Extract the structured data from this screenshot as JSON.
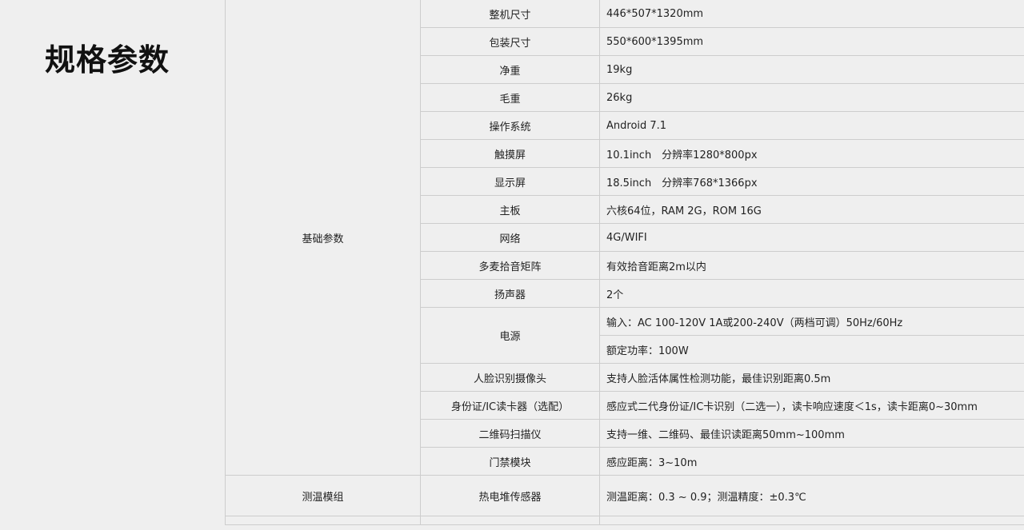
{
  "page_title": "规格参数",
  "groups": {
    "basic": "基础参数",
    "temp": "测温模组"
  },
  "rows": [
    {
      "item": "整机尺寸",
      "value": "446*507*1320mm"
    },
    {
      "item": "包装尺寸",
      "value": "550*600*1395mm"
    },
    {
      "item": "净重",
      "value": "19kg"
    },
    {
      "item": "毛重",
      "value": "26kg"
    },
    {
      "item": "操作系统",
      "value": "Android 7.1"
    },
    {
      "item": "触摸屏",
      "value": "10.1inch　分辨率1280*800px"
    },
    {
      "item": "显示屏",
      "value": "18.5inch　分辨率768*1366px"
    },
    {
      "item": "主板",
      "value": "六核64位，RAM 2G，ROM 16G"
    },
    {
      "item": "网络",
      "value": "4G/WIFI"
    },
    {
      "item": "多麦拾音矩阵",
      "value": "有效拾音距离2m以内"
    },
    {
      "item": "扬声器",
      "value": "2个"
    },
    {
      "item": "电源",
      "value": "输入：AC 100-120V 1A或200-240V（两档可调）50Hz/60Hz",
      "value2": "额定功率：100W"
    },
    {
      "item": "人脸识别摄像头",
      "value": "支持人脸活体属性检测功能，最佳识别距离0.5m"
    },
    {
      "item": "身份证/IC读卡器（选配）",
      "value": "感应式二代身份证/IC卡识别（二选一），读卡响应速度＜1s，读卡距离0~30mm"
    },
    {
      "item": "二维码扫描仪",
      "value": "支持一维、二维码、最佳识读距离50mm~100mm"
    },
    {
      "item": "门禁模块",
      "value": "感应距离：3~10m"
    },
    {
      "item": "热电堆传感器",
      "value": "测温距离：0.3 ~ 0.9；测温精度：±0.3℃"
    }
  ]
}
